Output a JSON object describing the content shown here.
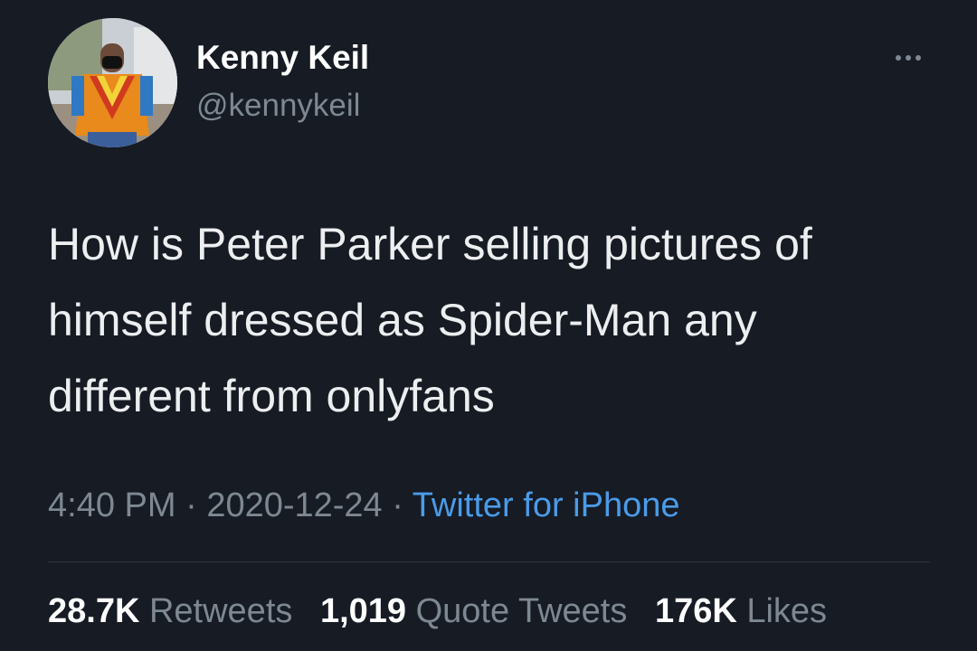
{
  "author": {
    "name": "Kenny Keil",
    "handle": "@kennykeil"
  },
  "more_icon": "more-horizontal-icon",
  "tweet": {
    "text": "How is Peter Parker selling pictures of\nhimself dressed as Spider-Man any\ndifferent from onlyfans",
    "time": "4:40 PM",
    "separator": " · ",
    "date": "2020-12-24",
    "source": "Twitter for iPhone"
  },
  "stats": {
    "retweets": {
      "count": "28.7K",
      "label": "Retweets"
    },
    "quote_tweets": {
      "count": "1,019",
      "label": "Quote Tweets"
    },
    "likes": {
      "count": "176K",
      "label": "Likes"
    }
  },
  "colors": {
    "background": "#161b24",
    "primary_text": "#ffffff",
    "secondary_text": "#7e8892",
    "link": "#4a9be8"
  }
}
